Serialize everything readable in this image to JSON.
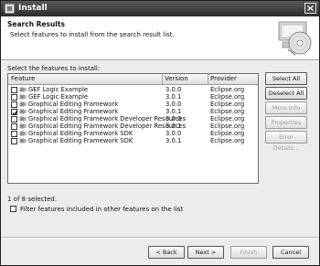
{
  "window": {
    "title": "Install"
  },
  "header": {
    "title": "Search Results",
    "description": "Select features to install from the search result list."
  },
  "list_label": "Select the features to install:",
  "table": {
    "columns": [
      "Feature",
      "Version",
      "Provider"
    ],
    "rows": [
      {
        "feature": "GEF Logic Example",
        "version": "3.0.0",
        "provider": "Eclipse.org",
        "checked": false
      },
      {
        "feature": "GEF Logic Example",
        "version": "3.0.1",
        "provider": "Eclipse.org",
        "checked": false
      },
      {
        "feature": "Graphical Editing Framework",
        "version": "3.0.0",
        "provider": "Eclipse.org",
        "checked": false
      },
      {
        "feature": "Graphical Editing Framework",
        "version": "3.0.1",
        "provider": "Eclipse.org",
        "checked": true
      },
      {
        "feature": "Graphical Editing Framework Developer Resources",
        "version": "3.0.0",
        "provider": "Eclipse.org",
        "checked": false
      },
      {
        "feature": "Graphical Editing Framework Developer Resources",
        "version": "3.0.1",
        "provider": "Eclipse.org",
        "checked": false
      },
      {
        "feature": "Graphical Editing Framework SDK",
        "version": "3.0.0",
        "provider": "Eclipse.org",
        "checked": false
      },
      {
        "feature": "Graphical Editing Framework SDK",
        "version": "3.0.1",
        "provider": "Eclipse.org",
        "checked": false
      }
    ]
  },
  "side_buttons": {
    "select_all": "Select All",
    "deselect_all": "Deselect All",
    "more_info": "More Info",
    "properties": "Properties",
    "error_details": "Error Details..."
  },
  "status": "1 of 8 selected.",
  "filter": {
    "label": "Filter features included in other features on the list",
    "checked": false
  },
  "footer": {
    "back": "< Back",
    "next": "Next >",
    "finish": "Finish",
    "cancel": "Cancel"
  },
  "icons": {
    "app": "install-icon",
    "close": "close-icon",
    "wizard": "cd-install-icon",
    "feature": "feature-plug-icon"
  }
}
